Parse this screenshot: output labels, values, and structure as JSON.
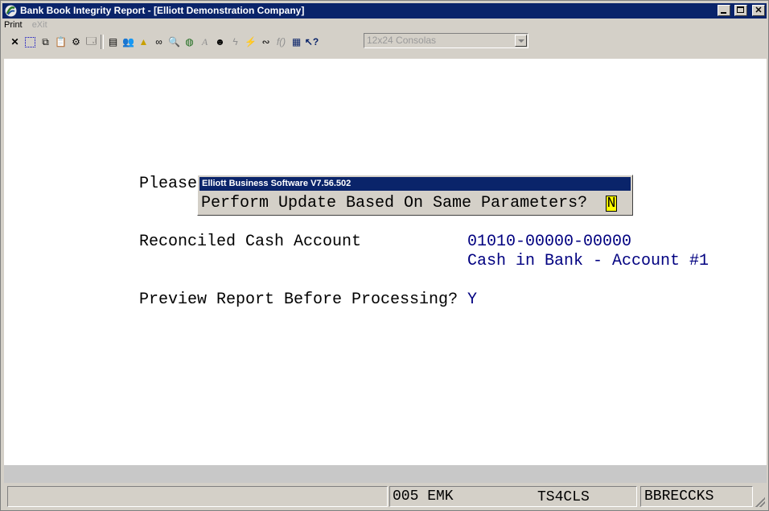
{
  "window": {
    "title": "Bank Book Integrity Report - [Elliott Demonstration Company]",
    "buttons": [
      "minimize",
      "maximize",
      "close"
    ]
  },
  "menu": {
    "print": "Print",
    "exit": "eXit"
  },
  "toolbar": {
    "icons": [
      "close-icon",
      "select-icon",
      "copy-icon",
      "paste-icon",
      "settings-icon",
      "properties-icon",
      "note-icon",
      "users-icon",
      "alert-icon",
      "binoculars-icon",
      "magnify-icon",
      "globe-icon",
      "font-icon",
      "person-icon",
      "lightning-icon",
      "lightning-box-icon",
      "link-icon",
      "function-icon",
      "calculator-icon",
      "help-pointer-icon"
    ],
    "font_select": "12x24 Consolas"
  },
  "screen": {
    "please_text": "Please",
    "account_label": "Reconciled Cash Account",
    "account_number": "01010-00000-00000",
    "account_name": "Cash in Bank - Account #1",
    "preview_label": "Preview Report Before Processing?",
    "preview_value": "Y"
  },
  "dialog": {
    "title": "Elliott Business Software V7.56.502",
    "question": "Perform Update Based On Same Parameters?",
    "answer": "N"
  },
  "statusbar": {
    "panel1": "",
    "panel2": "005 EMK",
    "panel3": "TS4CLS",
    "panel4": "BBRECCKS"
  }
}
